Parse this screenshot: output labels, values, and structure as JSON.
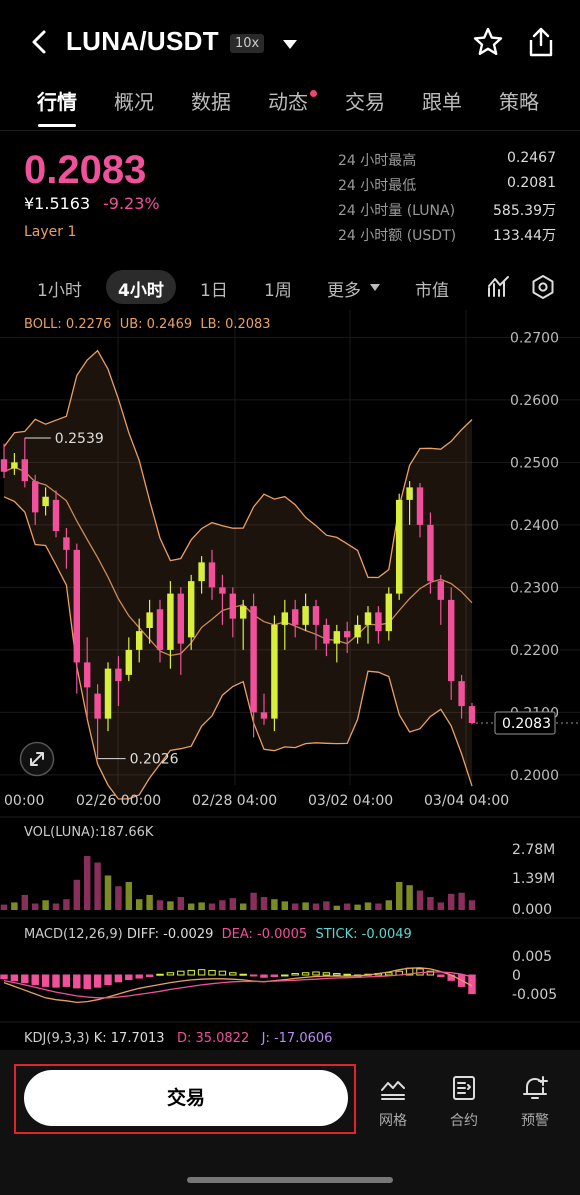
{
  "header": {
    "pair": "LUNA/USDT",
    "leverage": "10x",
    "icons": [
      "back-icon",
      "chevron-down-icon",
      "star-icon",
      "share-icon"
    ]
  },
  "tabs": [
    {
      "label": "行情",
      "active": true
    },
    {
      "label": "概况"
    },
    {
      "label": "数据"
    },
    {
      "label": "动态",
      "badge": true
    },
    {
      "label": "交易"
    },
    {
      "label": "跟单"
    },
    {
      "label": "策略"
    }
  ],
  "ticker": {
    "price": "0.2083",
    "price_cny": "¥1.5163",
    "change": "-9.23%",
    "tag": "Layer 1",
    "stats": [
      {
        "label": "24 小时最高",
        "value": "0.2467"
      },
      {
        "label": "24 小时最低",
        "value": "0.2081"
      },
      {
        "label": "24 小时量 (LUNA)",
        "value": "585.39万"
      },
      {
        "label": "24 小时额 (USDT)",
        "value": "133.44万"
      }
    ]
  },
  "intervals": [
    {
      "label": "1小时"
    },
    {
      "label": "4小时",
      "active": true
    },
    {
      "label": "1日"
    },
    {
      "label": "1周"
    },
    {
      "label": "更多"
    },
    {
      "label": "市值"
    }
  ],
  "colors": {
    "up": "#d8f03c",
    "down": "#f0519a",
    "boll_mid": "#e9a066",
    "boll_band": "#e9a066",
    "price": "#f0519a",
    "accent_red": "#e0242a"
  },
  "chart_data": {
    "type": "candlestick",
    "boll_legend": {
      "boll": "BOLL: 0.2276",
      "ub": "UB: 0.2469",
      "lb": "LB: 0.2083"
    },
    "y_ticks": [
      "0.2700",
      "0.2600",
      "0.2500",
      "0.2400",
      "0.2300",
      "0.2200",
      "0.2100",
      "0.2000"
    ],
    "y_range": [
      0.1995,
      0.2715
    ],
    "x_ticks": [
      "00:00",
      "02/26 00:00",
      "02/28 04:00",
      "03/02 04:00",
      "03/04 04:00"
    ],
    "last_price_label": "0.2083",
    "high_marker": "0.2539",
    "low_marker": "0.2026",
    "candles": [
      [
        0.2505,
        0.2485,
        0.253,
        0.2475
      ],
      [
        0.249,
        0.25,
        0.2515,
        0.248
      ],
      [
        0.2505,
        0.247,
        0.2539,
        0.246
      ],
      [
        0.247,
        0.242,
        0.248,
        0.24
      ],
      [
        0.243,
        0.2445,
        0.246,
        0.2415
      ],
      [
        0.244,
        0.239,
        0.2455,
        0.238
      ],
      [
        0.238,
        0.236,
        0.2395,
        0.233
      ],
      [
        0.236,
        0.218,
        0.237,
        0.213
      ],
      [
        0.218,
        0.214,
        0.222,
        0.209
      ],
      [
        0.213,
        0.209,
        0.2145,
        0.2026
      ],
      [
        0.209,
        0.217,
        0.218,
        0.207
      ],
      [
        0.217,
        0.215,
        0.219,
        0.211
      ],
      [
        0.216,
        0.22,
        0.222,
        0.215
      ],
      [
        0.22,
        0.223,
        0.225,
        0.218
      ],
      [
        0.2235,
        0.226,
        0.228,
        0.221
      ],
      [
        0.2265,
        0.22,
        0.228,
        0.218
      ],
      [
        0.22,
        0.229,
        0.231,
        0.217
      ],
      [
        0.229,
        0.221,
        0.23,
        0.216
      ],
      [
        0.222,
        0.231,
        0.232,
        0.22
      ],
      [
        0.231,
        0.234,
        0.235,
        0.229
      ],
      [
        0.234,
        0.23,
        0.236,
        0.228
      ],
      [
        0.23,
        0.229,
        0.232,
        0.224
      ],
      [
        0.229,
        0.225,
        0.23,
        0.222
      ],
      [
        0.225,
        0.227,
        0.228,
        0.22
      ],
      [
        0.227,
        0.21,
        0.229,
        0.206
      ],
      [
        0.21,
        0.209,
        0.213,
        0.208
      ],
      [
        0.209,
        0.224,
        0.2255,
        0.207
      ],
      [
        0.224,
        0.226,
        0.228,
        0.22
      ],
      [
        0.2265,
        0.224,
        0.228,
        0.222
      ],
      [
        0.224,
        0.227,
        0.229,
        0.223
      ],
      [
        0.227,
        0.224,
        0.228,
        0.22
      ],
      [
        0.224,
        0.221,
        0.225,
        0.219
      ],
      [
        0.221,
        0.223,
        0.224,
        0.218
      ],
      [
        0.223,
        0.222,
        0.2245,
        0.2195
      ],
      [
        0.222,
        0.224,
        0.2255,
        0.221
      ],
      [
        0.224,
        0.226,
        0.227,
        0.221
      ],
      [
        0.226,
        0.223,
        0.227,
        0.221
      ],
      [
        0.223,
        0.229,
        0.23,
        0.2215
      ],
      [
        0.229,
        0.244,
        0.245,
        0.228
      ],
      [
        0.244,
        0.246,
        0.247,
        0.24
      ],
      [
        0.246,
        0.24,
        0.2467,
        0.238
      ],
      [
        0.24,
        0.231,
        0.242,
        0.229
      ],
      [
        0.231,
        0.228,
        0.232,
        0.224
      ],
      [
        0.228,
        0.215,
        0.23,
        0.212
      ],
      [
        0.215,
        0.211,
        0.216,
        0.209
      ],
      [
        0.211,
        0.2083,
        0.2115,
        0.2081
      ]
    ],
    "volume_legend": "VOL(LUNA):187.66K",
    "volume_ticks": [
      "2.78M",
      "1.39M",
      "0.000"
    ],
    "volume_range": [
      0,
      2780000
    ],
    "volumes": [
      0.25,
      0.35,
      0.7,
      0.3,
      0.45,
      0.3,
      0.5,
      1.4,
      2.5,
      2.2,
      1.6,
      1.1,
      1.3,
      0.5,
      0.7,
      0.45,
      0.4,
      0.6,
      0.3,
      0.35,
      0.3,
      0.45,
      0.55,
      0.3,
      0.8,
      0.6,
      0.5,
      0.4,
      0.3,
      0.35,
      0.3,
      0.4,
      0.2,
      0.3,
      0.25,
      0.35,
      0.3,
      0.45,
      1.3,
      1.15,
      0.9,
      0.6,
      0.35,
      0.75,
      0.8,
      0.45
    ],
    "macd_legend": {
      "name": "MACD(12,26,9)",
      "diff": "DIFF: -0.0029",
      "dea": "DEA: -0.0005",
      "stick": "STICK: -0.0049"
    },
    "macd_ticks": [
      "0.005",
      "0",
      "-0.005"
    ],
    "macd_range": [
      -0.008,
      0.008
    ],
    "macd_stick": [
      -0.001,
      -0.0015,
      -0.002,
      -0.0025,
      -0.003,
      -0.0032,
      -0.003,
      -0.0034,
      -0.0036,
      -0.0032,
      -0.0025,
      -0.0018,
      -0.0012,
      -0.0008,
      -0.0004,
      0.0002,
      0.0006,
      0.001,
      0.0012,
      0.0014,
      0.0012,
      0.001,
      0.0006,
      0.0002,
      -0.0002,
      -0.0006,
      -0.0004,
      0.0,
      0.0004,
      0.0006,
      0.0008,
      0.0006,
      0.0004,
      0.0002,
      0.0,
      0.0002,
      0.0004,
      0.0006,
      0.001,
      0.0018,
      0.0016,
      0.001,
      -0.0004,
      -0.0014,
      -0.003,
      -0.0049
    ],
    "macd_diff": [
      -0.002,
      -0.003,
      -0.004,
      -0.005,
      -0.006,
      -0.0065,
      -0.0068,
      -0.0072,
      -0.007,
      -0.0065,
      -0.0058,
      -0.005,
      -0.0042,
      -0.0035,
      -0.003,
      -0.0025,
      -0.002,
      -0.0016,
      -0.0013,
      -0.0011,
      -0.001,
      -0.001,
      -0.0011,
      -0.0013,
      -0.0016,
      -0.0018,
      -0.0015,
      -0.0012,
      -0.0009,
      -0.0006,
      -0.0004,
      -0.0003,
      -0.0003,
      -0.0003,
      -0.0002,
      0.0,
      0.0004,
      0.0008,
      0.0014,
      0.0018,
      0.0019,
      0.0016,
      0.0009,
      0.0,
      -0.0014,
      -0.0029
    ],
    "macd_dea": [
      -0.0015,
      -0.002,
      -0.0026,
      -0.0032,
      -0.0039,
      -0.0045,
      -0.005,
      -0.0055,
      -0.0058,
      -0.006,
      -0.006,
      -0.0058,
      -0.0055,
      -0.0051,
      -0.0047,
      -0.0043,
      -0.0038,
      -0.0034,
      -0.003,
      -0.0026,
      -0.0023,
      -0.002,
      -0.0018,
      -0.0017,
      -0.0017,
      -0.0017,
      -0.0016,
      -0.0015,
      -0.0014,
      -0.0012,
      -0.0011,
      -0.0009,
      -0.0008,
      -0.0007,
      -0.0006,
      -0.0005,
      -0.0004,
      -0.0002,
      0.0,
      0.0003,
      0.0006,
      0.0008,
      0.0008,
      0.0006,
      0.0002,
      -0.0005
    ],
    "kdj_legend": {
      "name": "KDJ(9,3,3)",
      "k": "K: 17.7013",
      "d": "D: 35.0822",
      "j": "J: -17.0606"
    }
  },
  "bottom_bar": {
    "trade_button": "交易",
    "items": [
      {
        "label": "网格",
        "icon": "grid-chart-icon"
      },
      {
        "label": "合约",
        "icon": "contract-icon"
      },
      {
        "label": "预警",
        "icon": "alert-bell-icon"
      }
    ]
  }
}
